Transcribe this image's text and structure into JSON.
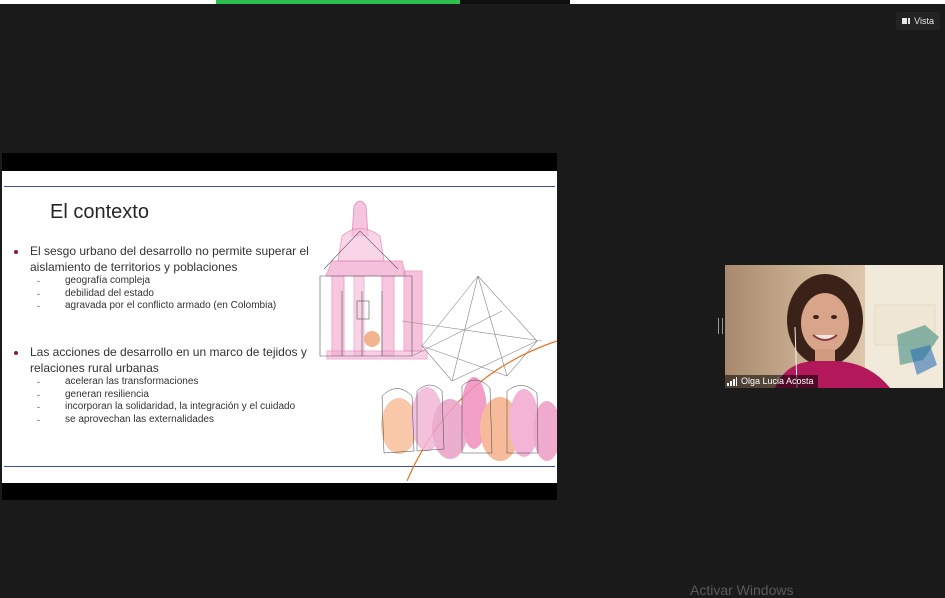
{
  "toolbar": {
    "view_label": "Vista",
    "view_icon": "view-layout-icon"
  },
  "slide": {
    "title": "El contexto",
    "bullets": [
      {
        "text": "El sesgo urbano del desarrollo no permite superar el aislamiento de territorios y poblaciones",
        "subitems": [
          "geografía compleja",
          "debilidad del estado",
          "agravada por el conflicto armado (en Colombia)"
        ]
      },
      {
        "text": "Las acciones de desarrollo en un marco de tejidos y relaciones rural urbanas",
        "subitems": [
          "aceleran las transformaciones",
          "generan resiliencia",
          "incorporan la solidaridad, la integración y el cuidado",
          "se aprovechan las externalidades"
        ]
      }
    ],
    "accent_color": "#3a4fa3",
    "bullet_color": "#8b1d2c"
  },
  "participant": {
    "name": "Olga Lucia Acosta",
    "signal_icon": "signal-bars-icon"
  },
  "system": {
    "watermark": "Activar Windows"
  },
  "colors": {
    "background": "#1a1a1a",
    "share_indicator": "#2fbf4f"
  }
}
